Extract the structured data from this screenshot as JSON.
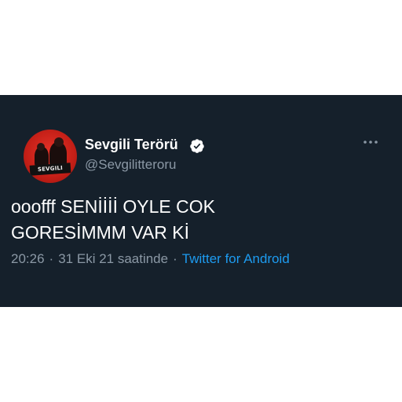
{
  "tweet": {
    "author": {
      "display_name": "Sevgili Terörü",
      "handle": "@Sevgilitteroru",
      "verified": true,
      "avatar_logo_text": "SEVGILI",
      "avatar_icon": "profile-photo"
    },
    "text_lines": [
      "ooofff SENİİİİ OYLE COK",
      "GORESİMMM VAR Kİ"
    ],
    "time": "20:26",
    "date": "31 Eki 21 saatinde",
    "separator": "·",
    "source": "Twitter for Android",
    "menu_icon": "more-horizontal-icon"
  },
  "colors": {
    "background": "#15202b",
    "text_primary": "#ffffff",
    "text_secondary": "#8b98a5",
    "link": "#1d9bf0",
    "page": "#ffffff"
  }
}
